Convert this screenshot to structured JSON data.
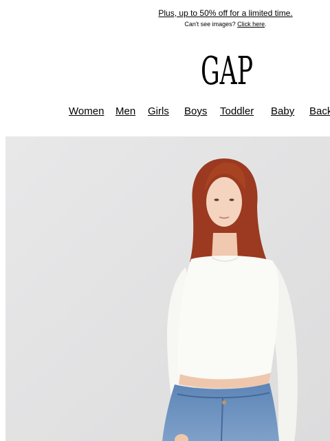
{
  "preheader": {
    "promo_text": "Plus, up to 50% off for a limited time.",
    "images_prefix": "Can't see images? ",
    "images_link": "Click here",
    "images_suffix": "."
  },
  "brand": {
    "logo_text": "GAP",
    "logo_color": "#000000"
  },
  "nav": {
    "items": [
      "Women",
      "Men",
      "Girls",
      "Boys",
      "Toddler",
      "Baby",
      "Back"
    ]
  },
  "hero": {
    "description": "hero-image",
    "background_color": "#e3e3e4"
  }
}
